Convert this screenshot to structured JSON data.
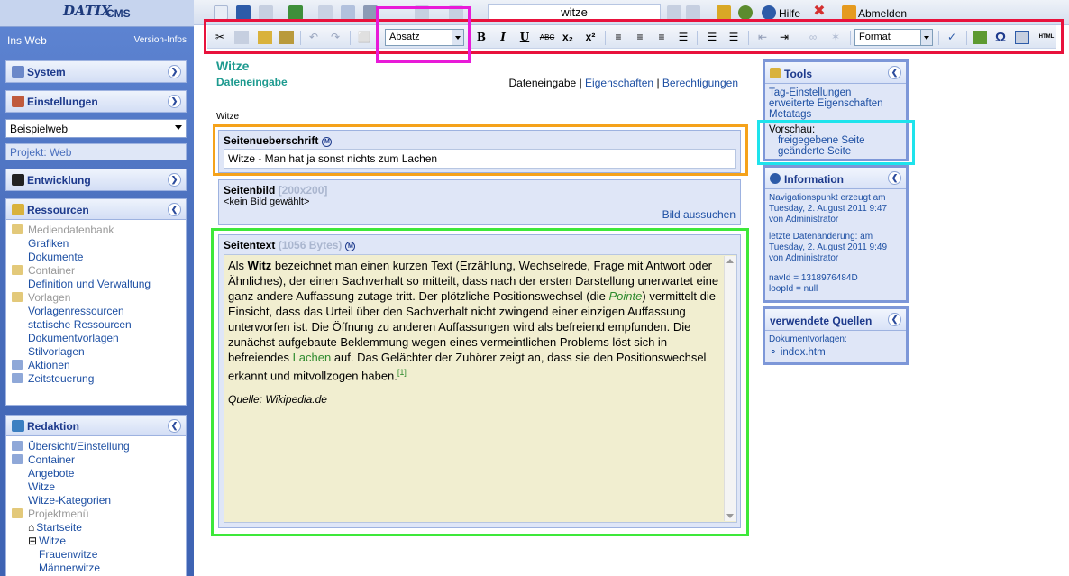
{
  "brand": {
    "logo": "DATIX",
    "product": "CMS"
  },
  "sidebar": {
    "web_link": "Ins Web",
    "version_link": "Version-Infos",
    "system": "System",
    "settings": "Einstellungen",
    "site_select": "Beispielweb",
    "project": "Projekt: Web",
    "development": "Entwicklung",
    "resources": {
      "title": "Ressourcen",
      "items": [
        {
          "label": "Mediendatenbank",
          "level": 0,
          "dim": true
        },
        {
          "label": "Grafiken",
          "level": 1
        },
        {
          "label": "Dokumente",
          "level": 1
        },
        {
          "label": "Container",
          "level": 0,
          "dim": true
        },
        {
          "label": "Definition und Verwaltung",
          "level": 1
        },
        {
          "label": "Vorlagen",
          "level": 0,
          "dim": true
        },
        {
          "label": "Vorlagenressourcen",
          "level": 1
        },
        {
          "label": "statische Ressourcen",
          "level": 1
        },
        {
          "label": "Dokumentvorlagen",
          "level": 1
        },
        {
          "label": "Stilvorlagen",
          "level": 1
        },
        {
          "label": "Aktionen",
          "level": 0
        },
        {
          "label": "Zeitsteuerung",
          "level": 0
        }
      ]
    },
    "editorial": {
      "title": "Redaktion",
      "items": [
        {
          "label": "Übersicht/Einstellung",
          "level": 0
        },
        {
          "label": "Container",
          "level": 0
        },
        {
          "label": "Angebote",
          "level": 1
        },
        {
          "label": "Witze",
          "level": 1
        },
        {
          "label": "Witze-Kategorien",
          "level": 1
        },
        {
          "label": "Projektmenü",
          "level": 0,
          "dim": true
        },
        {
          "label": "Startseite",
          "level": 2
        },
        {
          "label": "Witze",
          "level": 2
        },
        {
          "label": "Frauenwitze",
          "level": 3
        },
        {
          "label": "Männerwitze",
          "level": 3
        }
      ]
    }
  },
  "topbar": {
    "search_value": "witze",
    "help": "Hilfe",
    "logout": "Abmelden"
  },
  "editor_toolbar": {
    "paragraph_select": "Absatz",
    "format_select": "Format",
    "bold": "B",
    "italic": "I",
    "underline": "U",
    "strike": "ABC",
    "subscript": "x₂",
    "superscript": "x²",
    "omega": "Ω",
    "html": "HTML"
  },
  "main": {
    "title": "Witze",
    "subtitle": "Dateneingabe",
    "tabs": [
      "Dateneingabe",
      "Eigenschaften",
      "Berechtigungen"
    ],
    "separator": "|",
    "breadcrumb": "Witze",
    "heading_field": {
      "label": "Seitenueberschrift",
      "value": "Witze - Man hat ja sonst nichts zum Lachen",
      "meta_icon": "M"
    },
    "image_field": {
      "label": "Seitenbild",
      "size": "[200x200]",
      "value": "<kein Bild gewählt>",
      "action": "Bild aussuchen"
    },
    "text_field": {
      "label": "Seitentext",
      "size": "(1056 Bytes)",
      "meta_icon": "M",
      "p1_a": "Als ",
      "p1_bold": "Witz",
      "p1_b": " bezeichnet man einen kurzen Text (Erzählung, Wechselrede, Frage mit Antwort oder Ähnliches), der einen Sachverhalt so mitteilt, dass nach der ersten Darstellung unerwartet eine ganz andere Auffassung zutage tritt. Der plötzliche Positionswechsel (die ",
      "p1_italic": "Pointe",
      "p1_c": ") vermittelt die Einsicht, dass das Urteil über den Sachverhalt nicht zwingend einer einzigen Auffassung unterworfen ist. Die Öffnung zu anderen Auffassungen wird als befreiend empfunden. Die zunächst aufgebaute Beklemmung wegen eines vermeintlichen Problems löst sich in befreiendes ",
      "p1_link": "Lachen",
      "p1_d": " auf. Das Gelächter der Zuhörer zeigt an, dass sie den Positionswechsel erkannt und mitvollzogen haben.",
      "footnote": "[1]",
      "source": "Quelle: Wikipedia.de"
    }
  },
  "right": {
    "tools": {
      "title": "Tools",
      "links": [
        "Tag-Einstellungen",
        "erweiterte Eigenschaften",
        "Metatags"
      ],
      "preview_label": "Vorschau:",
      "preview_links": [
        "freigegebene Seite",
        "geänderte Seite"
      ]
    },
    "info": {
      "title": "Information",
      "created_label": "Navigationspunkt erzeugt am",
      "created_date": "Tuesday, 2. August 2011 9:47",
      "created_by": "von Administrator",
      "changed_label": "letzte Datenänderung: am",
      "changed_date": "Tuesday, 2. August 2011 9:49",
      "changed_by": "von Administrator",
      "nav_id": "navId = 1318976484D",
      "loop_id": "loopId = null"
    },
    "sources": {
      "title": "verwendete Quellen",
      "label": "Dokumentvorlagen:",
      "item": "index.htm"
    }
  },
  "colors": {
    "highlight_red": "#e8123c",
    "highlight_magenta": "#e81ad8",
    "highlight_orange": "#f5a21a",
    "highlight_cyan": "#1ee3ec",
    "highlight_green": "#3ee83a",
    "sidebar_blue": "#4a6fbd",
    "title_teal": "#1d9a8f"
  }
}
